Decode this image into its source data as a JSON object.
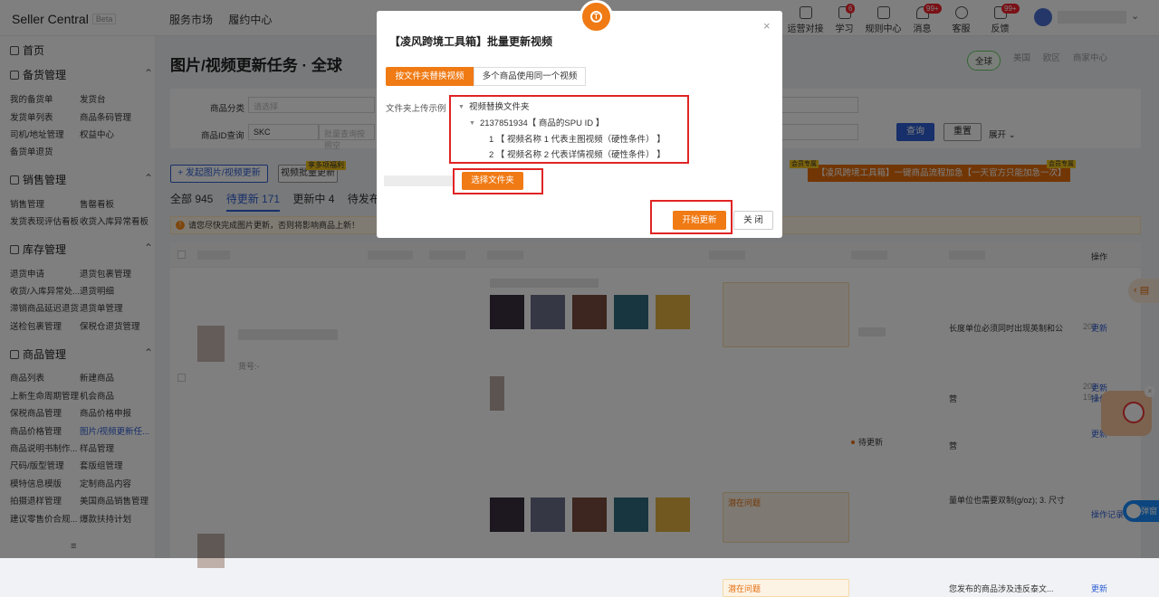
{
  "header": {
    "brand": "Seller Central",
    "beta": "Beta",
    "nav": [
      "服务市场",
      "履约中心"
    ],
    "icons": [
      {
        "name": "operations-icon",
        "label": "运营对接",
        "badge": ""
      },
      {
        "name": "learn-icon",
        "label": "学习",
        "badge": "6"
      },
      {
        "name": "rules-icon",
        "label": "规则中心",
        "badge": ""
      },
      {
        "name": "message-icon",
        "label": "消息",
        "badge": "99+"
      },
      {
        "name": "service-icon",
        "label": "客服",
        "badge": ""
      },
      {
        "name": "feedback-icon",
        "label": "反馈",
        "badge": "99+"
      }
    ]
  },
  "sidebar": {
    "home": "首页",
    "sections": [
      {
        "title": "备货管理",
        "items": [
          "我的备货单",
          "发货台",
          "发货单列表",
          "商品条码管理",
          "司机/地址管理",
          "权益中心",
          "备货单退货"
        ]
      },
      {
        "title": "销售管理",
        "items": [
          "销售管理",
          "售罄看板",
          "发货表现评估看板",
          "收货入库异常看板"
        ]
      },
      {
        "title": "库存管理",
        "items": [
          "退货申请",
          "退货包裹管理",
          "收货/入库异常处...",
          "退货明细",
          "滞销商品延迟退货",
          "退货单管理",
          "送检包裹管理",
          "保税仓退货管理"
        ]
      },
      {
        "title": "商品管理",
        "items": [
          "商品列表",
          "新建商品",
          "上新生命周期管理",
          "机会商品",
          "保税商品管理",
          "商品价格申报",
          "商品价格管理",
          "图片/视频更新任...",
          "商品说明书制作...",
          "样品管理",
          "尺码/版型管理",
          "套版组管理",
          "模特信息模版",
          "定制商品内容",
          "拍摄退样管理",
          "美国商品销售管理",
          "建议零售价合规...",
          "爆款扶持计划"
        ]
      }
    ],
    "active_item": "图片/视频更新任..."
  },
  "main": {
    "title": "图片/视频更新任务 · 全球",
    "regions": [
      "全球",
      "美国",
      "欧区",
      "商家中心"
    ],
    "filter": {
      "category_label": "商品分类",
      "category_placeholder": "请选择",
      "id_label": "商品ID查询",
      "id_type": "SKC",
      "id_placeholder": "批量查询按照空",
      "query": "查询",
      "reset": "重置",
      "expand": "展开"
    },
    "actions": {
      "create": "+ 发起图片/视频更新",
      "batch": "视频批量更新",
      "batch_tag": "享多项福利",
      "banner": "【凌风跨境工具箱】一键商品流程加急【一天官方只能加急一次】",
      "tag_left": "会员专属",
      "tag_right": "会员专属"
    },
    "tabs": [
      {
        "label": "全部 945"
      },
      {
        "label": "待更新 171"
      },
      {
        "label": "更新中 4"
      },
      {
        "label": "待发布 67"
      }
    ],
    "notice": "请您尽快完成图片更新，否则将影响商品上新！",
    "table": {
      "col_action": "操作",
      "potential_issue": "潜在问题",
      "status_pending": "待更新",
      "row_texts": [
        "长度单位必须同时出现英制和公",
        "营",
        "营",
        "量单位也需要双制(g/oz); 3. 尺寸",
        "您发布的商品涉及违反泰文..."
      ],
      "goods_no": "货号:-",
      "update": "更新",
      "history": "操作记录",
      "date_a": "202",
      "date_b": "19:1"
    }
  },
  "modal": {
    "title": "【凌风跨境工具箱】批量更新视频",
    "tab_folder": "按文件夹替换视频",
    "tab_multi": "多个商品使用同一个视频",
    "example_label": "文件夹上传示例",
    "tree": {
      "root": "视频替换文件夹",
      "child": "2137851934【 商品的SPU ID 】",
      "leaf1": "1 【 视频名称 1 代表主图视频（硬性条件） 】",
      "leaf2": "2 【 视频名称 2 代表详情视频（硬性条件） 】"
    },
    "select_folder": "选择文件夹",
    "start": "开始更新",
    "close": "关 闭"
  },
  "floating": {
    "pill_text": "弹窗"
  },
  "colors": {
    "accent_blue": "#2f5fd4",
    "accent_orange": "#f07a14",
    "highlight_red": "#e02424"
  }
}
